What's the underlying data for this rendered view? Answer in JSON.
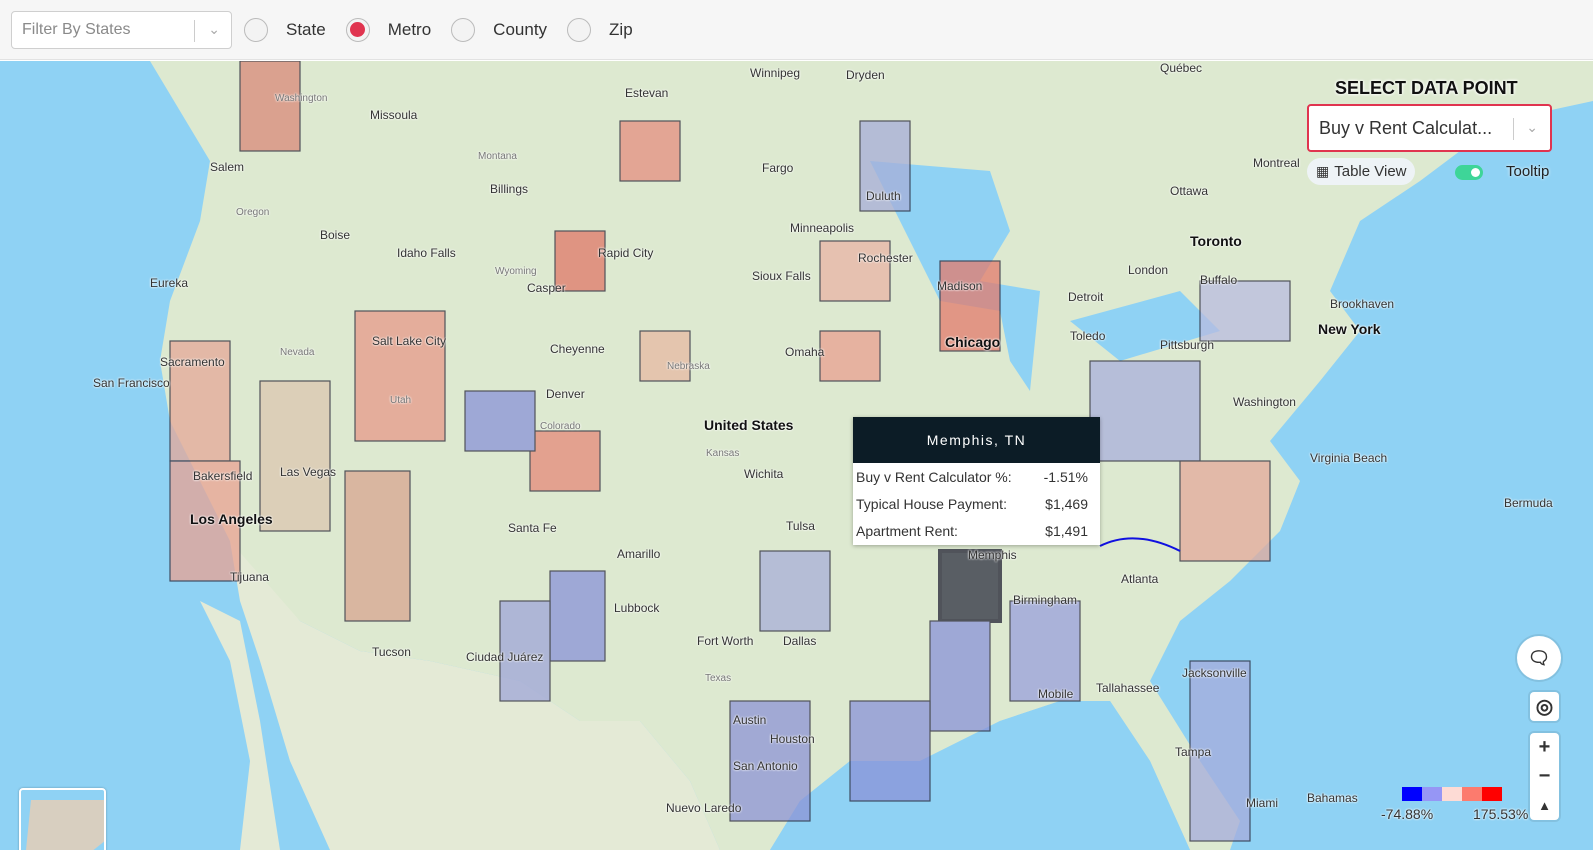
{
  "topbar": {
    "filter_placeholder": "Filter By States",
    "levels": [
      {
        "label": "State",
        "selected": false
      },
      {
        "label": "Metro",
        "selected": true
      },
      {
        "label": "County",
        "selected": false
      },
      {
        "label": "Zip",
        "selected": false
      }
    ]
  },
  "panel": {
    "title": "SELECT DATA POINT",
    "selected": "Buy v Rent Calculat...",
    "table_view": "Table View",
    "tooltip_label": "Tooltip",
    "tooltip_on": true
  },
  "tooltip": {
    "title": "Memphis, TN",
    "rows": [
      {
        "label": "Buy v Rent Calculator %:",
        "value": "-1.51%"
      },
      {
        "label": "Typical House Payment:",
        "value": "$1,469"
      },
      {
        "label": "Apartment Rent:",
        "value": "$1,491"
      }
    ]
  },
  "legend": {
    "min": "-74.88%",
    "max": "175.53%",
    "colors": [
      "#0000ff",
      "#9696f5",
      "#fddbd5",
      "#fc7b6e",
      "#ff0000"
    ]
  },
  "cities": [
    "Winnipeg",
    "Dryden",
    "Estevan",
    "Québec",
    "Montreal",
    "Ottawa",
    "Toronto",
    "London",
    "Buffalo",
    "New York",
    "Brookhaven",
    "Pittsburgh",
    "Washington",
    "Virginia Beach",
    "Bermuda",
    "Detroit",
    "Toledo",
    "Chicago",
    "Madison",
    "Minneapolis",
    "Rochester",
    "Duluth",
    "Fargo",
    "Sioux Falls",
    "Omaha",
    "Rapid City",
    "Casper",
    "Billings",
    "Missoula",
    "Boise",
    "Idaho Falls",
    "Salem",
    "Eureka",
    "Sacramento",
    "San Francisco",
    "Salt Lake City",
    "Cheyenne",
    "Denver",
    "Las Vegas",
    "Bakersfield",
    "Los Angeles",
    "Tijuana",
    "Tucson",
    "Santa Fe",
    "Ciudad Juárez",
    "Amarillo",
    "Lubbock",
    "Fort Worth",
    "Dallas",
    "Austin",
    "Houston",
    "San Antonio",
    "Nuevo Laredo",
    "Tulsa",
    "Wichita",
    "Memphis",
    "Birmingham",
    "Atlanta",
    "Mobile",
    "Tallahassee",
    "Jacksonville",
    "Tampa",
    "Miami",
    "Bahamas",
    "United States",
    "Nevada",
    "Utah",
    "Colorado",
    "Kansas",
    "Nebraska",
    "Montana",
    "Wyoming",
    "Texas",
    "Oregon",
    "Washington"
  ]
}
